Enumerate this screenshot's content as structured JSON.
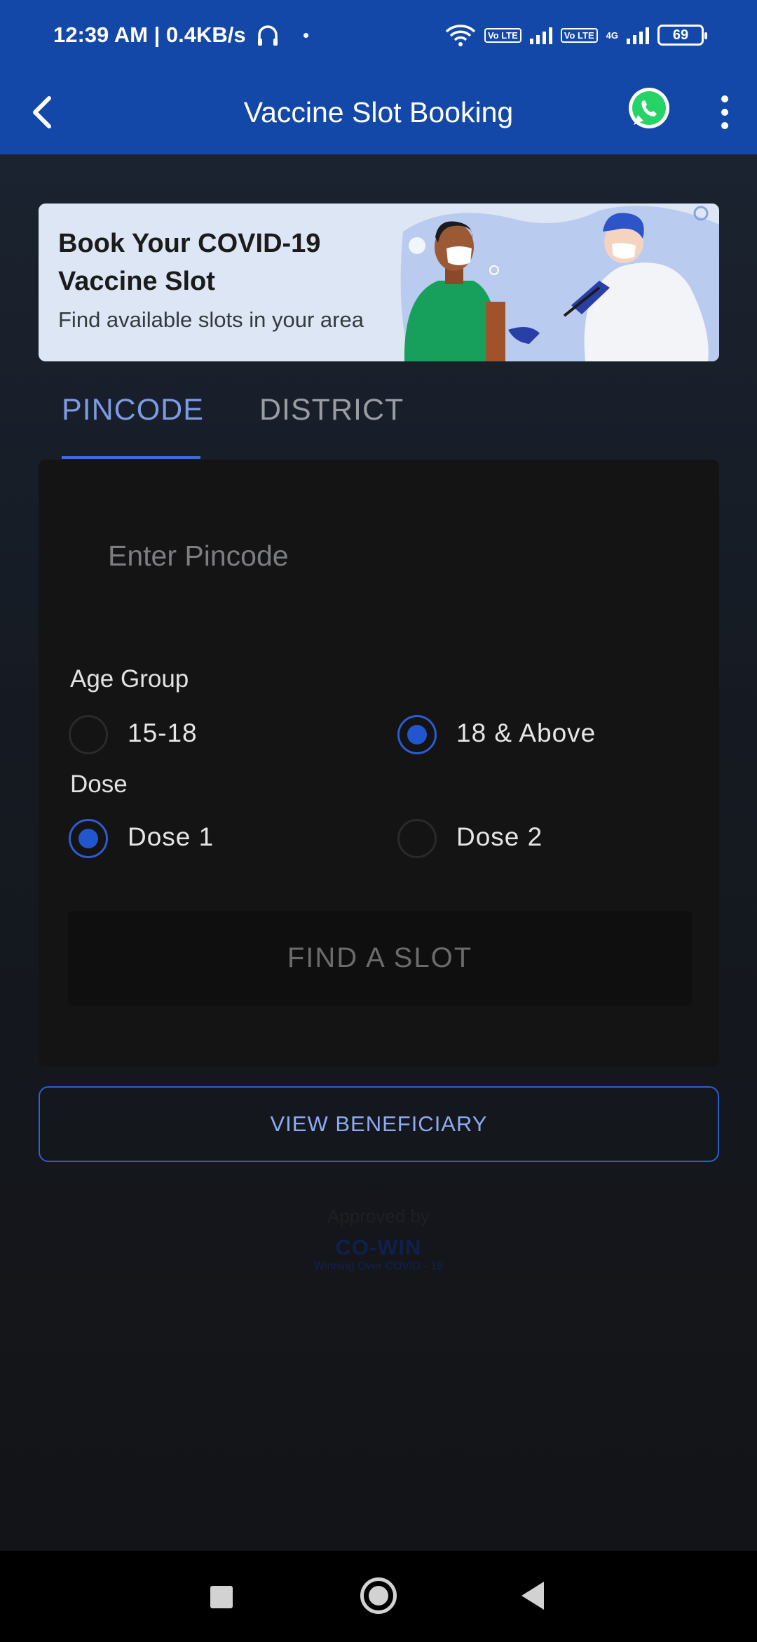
{
  "status_bar": {
    "time_speed": "12:39 AM | 0.4KB/s",
    "volte1": "Vo LTE",
    "volte2": "Vo LTE",
    "network": "4G",
    "battery": "69"
  },
  "app_bar": {
    "title": "Vaccine Slot Booking",
    "back_icon": "back-arrow-icon",
    "whatsapp_icon": "whatsapp-icon",
    "menu_icon": "more-vert-icon"
  },
  "banner": {
    "title": "Book Your COVID-19 Vaccine Slot",
    "subtitle": "Find available slots in your area"
  },
  "tabs": [
    {
      "label": "PINCODE",
      "selected": true
    },
    {
      "label": "DISTRICT",
      "selected": false
    }
  ],
  "form": {
    "pincode_placeholder": "Enter Pincode",
    "pincode_value": "",
    "age_group_label": "Age Group",
    "age_options": [
      {
        "label": "15-18",
        "checked": false
      },
      {
        "label": "18 & Above",
        "checked": true
      }
    ],
    "dose_label": "Dose",
    "dose_options": [
      {
        "label": "Dose 1",
        "checked": true
      },
      {
        "label": "Dose 2",
        "checked": false
      }
    ],
    "find_button": "FIND A SLOT"
  },
  "view_beneficiary_button": "VIEW BENEFICIARY",
  "approval": {
    "text": "Approved by",
    "logo": "CO-WIN",
    "tagline": "Winning Over COVID - 19"
  },
  "colors": {
    "primary": "#1448a8",
    "accent": "#2e5bd3",
    "background": "#131417",
    "banner": "#dce6f4"
  }
}
